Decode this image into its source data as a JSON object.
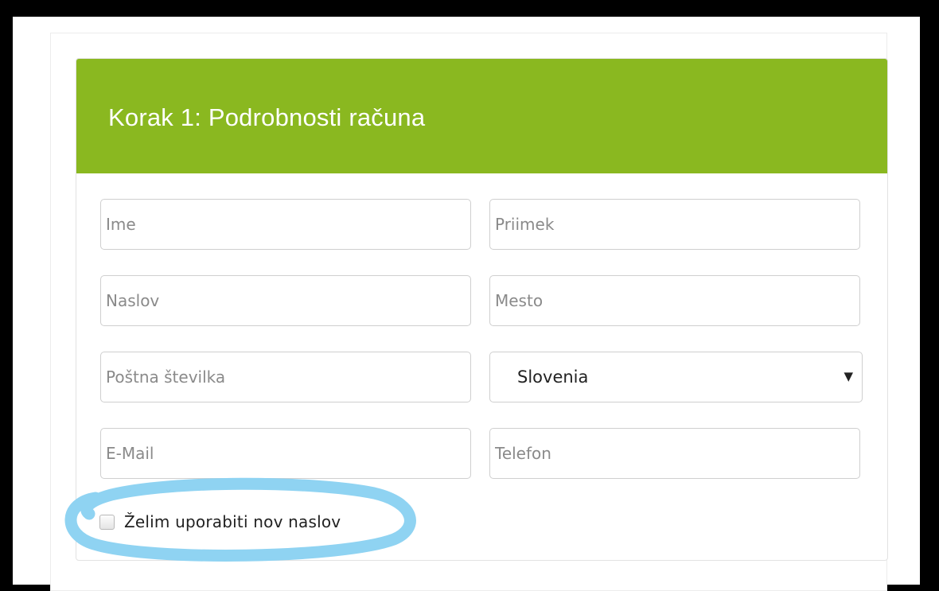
{
  "form": {
    "title": "Korak 1: Podrobnosti računa",
    "fields": {
      "first_name": {
        "placeholder": "Ime",
        "value": ""
      },
      "last_name": {
        "placeholder": "Priimek",
        "value": ""
      },
      "address": {
        "placeholder": "Naslov",
        "value": ""
      },
      "city": {
        "placeholder": "Mesto",
        "value": ""
      },
      "postal_code": {
        "placeholder": "Poštna številka",
        "value": ""
      },
      "country": {
        "selected": "Slovenia"
      },
      "email": {
        "placeholder": "E-Mail",
        "value": ""
      },
      "phone": {
        "placeholder": "Telefon",
        "value": ""
      }
    },
    "new_address_checkbox": {
      "label": "Želim uporabiti nov naslov",
      "checked": false
    },
    "dropdown_icon": "triangle-down"
  },
  "colors": {
    "header_green": "#8ab820",
    "annotation_blue": "#8fd3f2",
    "frame_black": "#000000"
  }
}
